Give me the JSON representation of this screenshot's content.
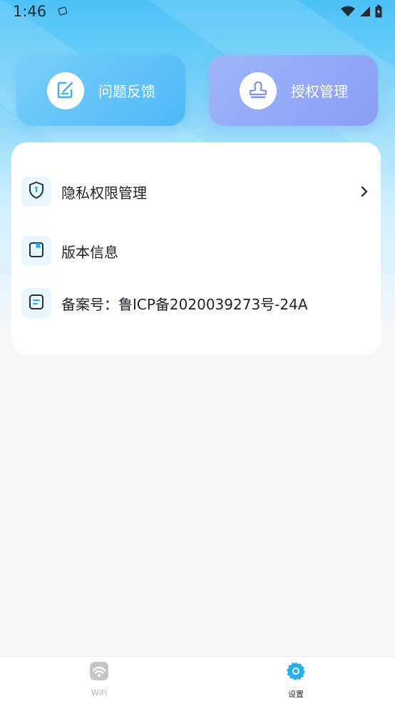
{
  "status_bar": {
    "time": "1:46"
  },
  "actions": {
    "feedback_label": "问题反馈",
    "auth_label": "授权管理"
  },
  "settings": {
    "items": [
      {
        "label": "隐私权限管理"
      },
      {
        "label": "版本信息"
      },
      {
        "label": "备案号：鲁ICP备2020039273号-24A"
      }
    ]
  },
  "bottom_nav": {
    "items": [
      {
        "label": "WiFi",
        "icon": "wifi-icon",
        "active": false
      },
      {
        "label": "设置",
        "icon": "gear-icon",
        "active": true
      }
    ]
  },
  "colors": {
    "accent": "#27aef0",
    "feedback_card": "#5bbcf8",
    "auth_card": "#8fa5f7",
    "text_primary": "#1f2329"
  }
}
